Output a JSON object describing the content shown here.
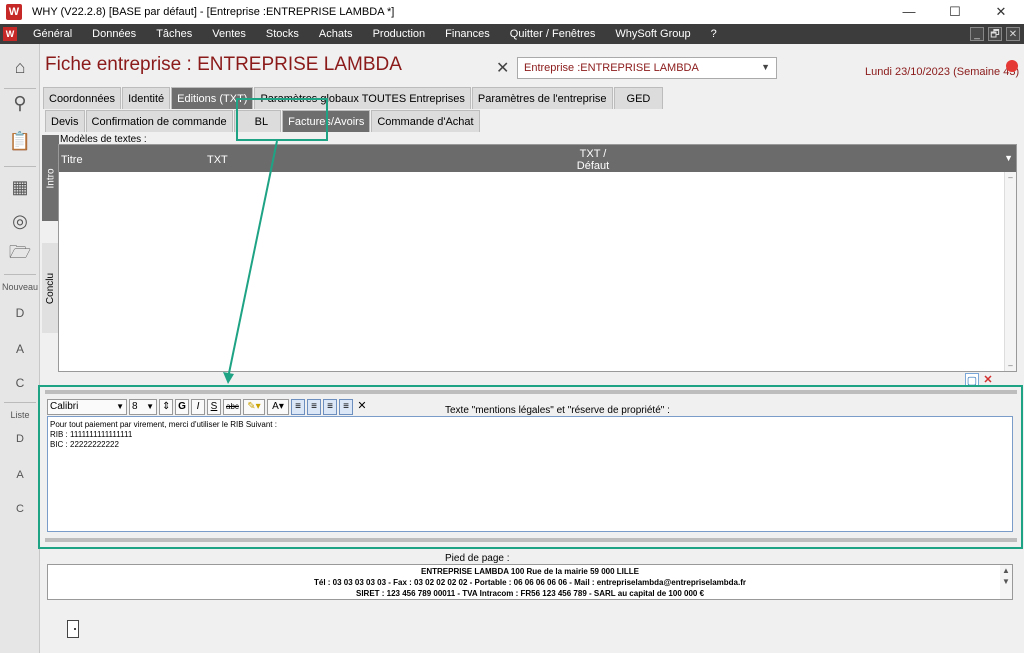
{
  "window": {
    "title": "WHY (V22.2.8)  [BASE par défaut] - [Entreprise :ENTREPRISE LAMBDA *]",
    "app_icon": "W",
    "controls": [
      "—",
      "☐",
      "✕"
    ]
  },
  "menu": {
    "icon": "W",
    "items": [
      "Général",
      "Données",
      "Tâches",
      "Ventes",
      "Stocks",
      "Achats",
      "Production",
      "Finances",
      "Quitter / Fenêtres",
      "WhySoft Group",
      "?"
    ],
    "mdi": [
      "_",
      "🗗",
      "✕"
    ]
  },
  "leftbar": {
    "nouveau_label": "Nouveau",
    "liste_label": "Liste",
    "icons": [
      "home-icon",
      "search-icon",
      "clipboard-icon",
      "calculator-icon",
      "web-icon",
      "folder-icon",
      "new-doc-d-icon",
      "new-doc-a-icon",
      "new-doc-c-icon",
      "list-d-icon",
      "list-a-icon",
      "list-c-icon"
    ],
    "glyphs": {
      "home": "⌂",
      "search": "⚲",
      "clipboard": "📋",
      "calculator": "▦",
      "web": "◎",
      "folder": "🗁",
      "new_d": "D",
      "new_a": "A",
      "new_c": "C",
      "list_d": "D",
      "list_a": "A",
      "list_c": "C"
    }
  },
  "header": {
    "title": "Fiche entreprise : ENTREPRISE LAMBDA",
    "close": "✕",
    "entreprise_select": "Entreprise :ENTREPRISE LAMBDA",
    "date": "Lundi 23/10/2023 (Semaine 43)",
    "status_color": "#e53935"
  },
  "tabs_main": [
    "Coordonnées",
    "Identité",
    "Editions (TXT)",
    "Paramètres globaux TOUTES Entreprises",
    "Paramètres de l'entreprise",
    "GED"
  ],
  "tabs_sub": [
    "Devis",
    "Confirmation de commande",
    "BL",
    "Factures/Avoirs",
    "Commande d'Achat"
  ],
  "vertical_tabs": [
    "Intro",
    "Conclu"
  ],
  "modeles": {
    "label": "Modèles de textes :",
    "columns": [
      "Titre",
      "TXT",
      "TXT /",
      "Défaut"
    ]
  },
  "editor": {
    "font": "Calibri",
    "size": "8",
    "buttons": [
      "G",
      "I",
      "S",
      "abc",
      "A"
    ],
    "mentions_label": "Texte \"mentions légales\" et \"réserve de propriété\" :",
    "lines": [
      "Pour tout paiement par virement, merci d'utiliser le RIB Suivant  :",
      "RIB : 1111111111111111",
      "BIC : 22222222222"
    ]
  },
  "footer": {
    "label": "Pied de page :",
    "lines": [
      "ENTREPRISE LAMBDA 100 Rue de la mairie 59 000 LILLE",
      "Tél : 03 03 03 03 03  - Fax : 03 02 02 02 02 - Portable : 06 06 06 06 06 - Mail : entrepriselambda@entrepriselambda.fr",
      "SIRET : 123 456 789 00011 - TVA Intracom : FR56 123 456 789 - SARL au capital de 100 000 €"
    ]
  },
  "colors": {
    "accent": "#8b1a1a",
    "callout": "#1fa385",
    "menubar": "#3c3c3c",
    "active_tab": "#6e6e6e"
  }
}
